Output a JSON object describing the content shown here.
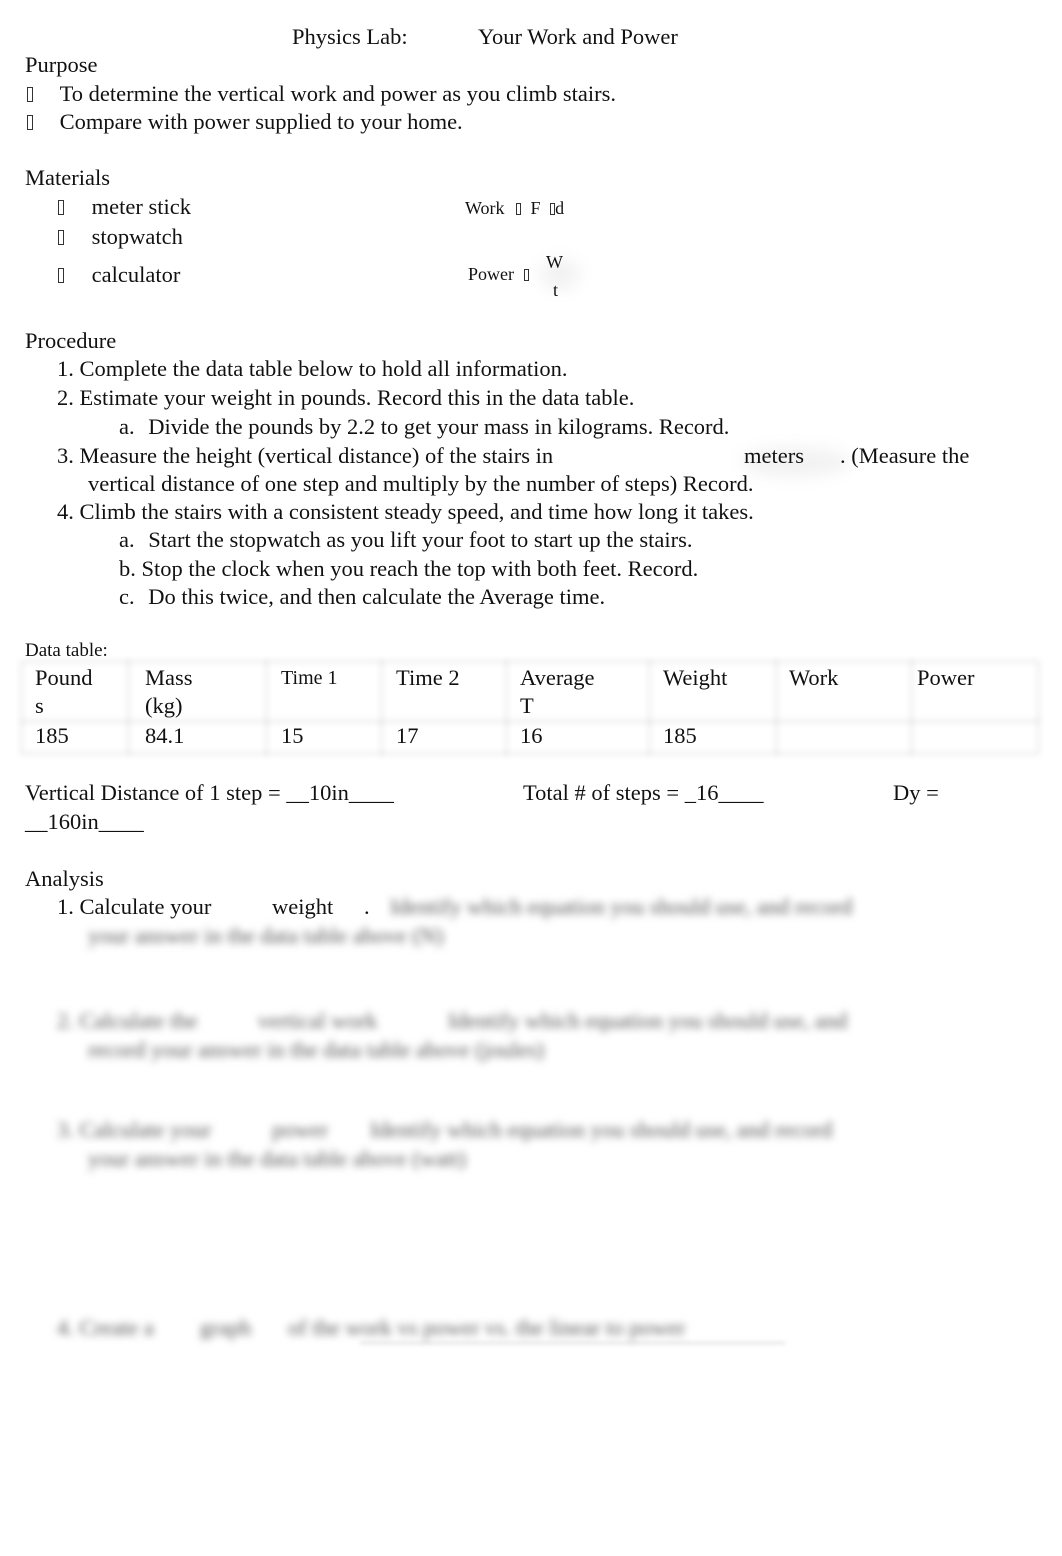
{
  "title": {
    "left": "Physics Lab:",
    "right": "Your Work and Power"
  },
  "purpose": {
    "heading": "Purpose",
    "items": [
      "To determine the vertical work and power as you climb stairs.",
      "Compare with power supplied to your home."
    ]
  },
  "materials": {
    "heading": "Materials",
    "items": [
      "meter stick",
      "stopwatch",
      "calculator"
    ]
  },
  "formulas": {
    "work": {
      "label": "Work",
      "f": "F",
      "d": "d"
    },
    "power": {
      "label": "Power",
      "numerator": "W",
      "denominator": "t"
    }
  },
  "procedure": {
    "heading": "Procedure",
    "step1": "1. Complete the data table below to hold all information.",
    "step2": "2. Estimate your weight in pounds. Record this in the data table.",
    "step2a_marker": "a.",
    "step2a": "Divide the pounds by 2.2 to get your mass in kilograms. Record.",
    "step3_a": "3. Measure the height (vertical distance) of the stairs in",
    "step3_unit": "meters",
    "step3_b": ". (Measure the",
    "step3_c": "vertical distance of one step and multiply by the number of steps) Record.",
    "step4": "4. Climb the stairs with a consistent steady speed, and time how long it takes.",
    "step4a_marker": "a.",
    "step4a": "Start the stopwatch as you lift your foot to start up the stairs.",
    "step4b": "b. Stop the clock when you reach the top with both feet. Record.",
    "step4c_marker": "c.",
    "step4c": "Do this twice, and then calculate the Average time."
  },
  "data_table": {
    "label": "Data table:",
    "headers": [
      [
        "Pound",
        "s"
      ],
      [
        "Mass",
        "(kg)"
      ],
      [
        "Time 1",
        ""
      ],
      [
        "Time 2",
        ""
      ],
      [
        "Average",
        "T"
      ],
      [
        "Weight",
        ""
      ],
      [
        "Work",
        ""
      ],
      [
        "Power",
        ""
      ]
    ],
    "values": [
      "185",
      "84.1",
      "15",
      "17",
      "16",
      "185",
      "",
      ""
    ]
  },
  "measurements": {
    "step_distance": "Vertical Distance of 1 step = __10in____",
    "total_steps": "Total # of steps = _16____",
    "dy_label": "Dy =",
    "dy_value": "__160in____"
  },
  "analysis": {
    "heading": "Analysis",
    "q1_prefix": "1. Calculate your",
    "q1_term": "weight",
    "q1_dot": ".",
    "q1_rest": "Identify which equation you should use, and record",
    "q1_rest2": "your answer in the data table above (N)",
    "q2_prefix": "2. Calculate the",
    "q2_term": "vertical work",
    "q2_rest": "Identify which equation you should use, and",
    "q2_rest2": "record your answer in the data table above (joules)",
    "q3_prefix": "3. Calculate your",
    "q3_term": "power",
    "q3_rest": "Identify which equation you should use, and record",
    "q3_rest2": "your answer in the data table above (watt)",
    "q4_prefix": "4. Create a",
    "q4_term": "graph",
    "q4_rest": "of the work vs power vs. the linear to power"
  }
}
